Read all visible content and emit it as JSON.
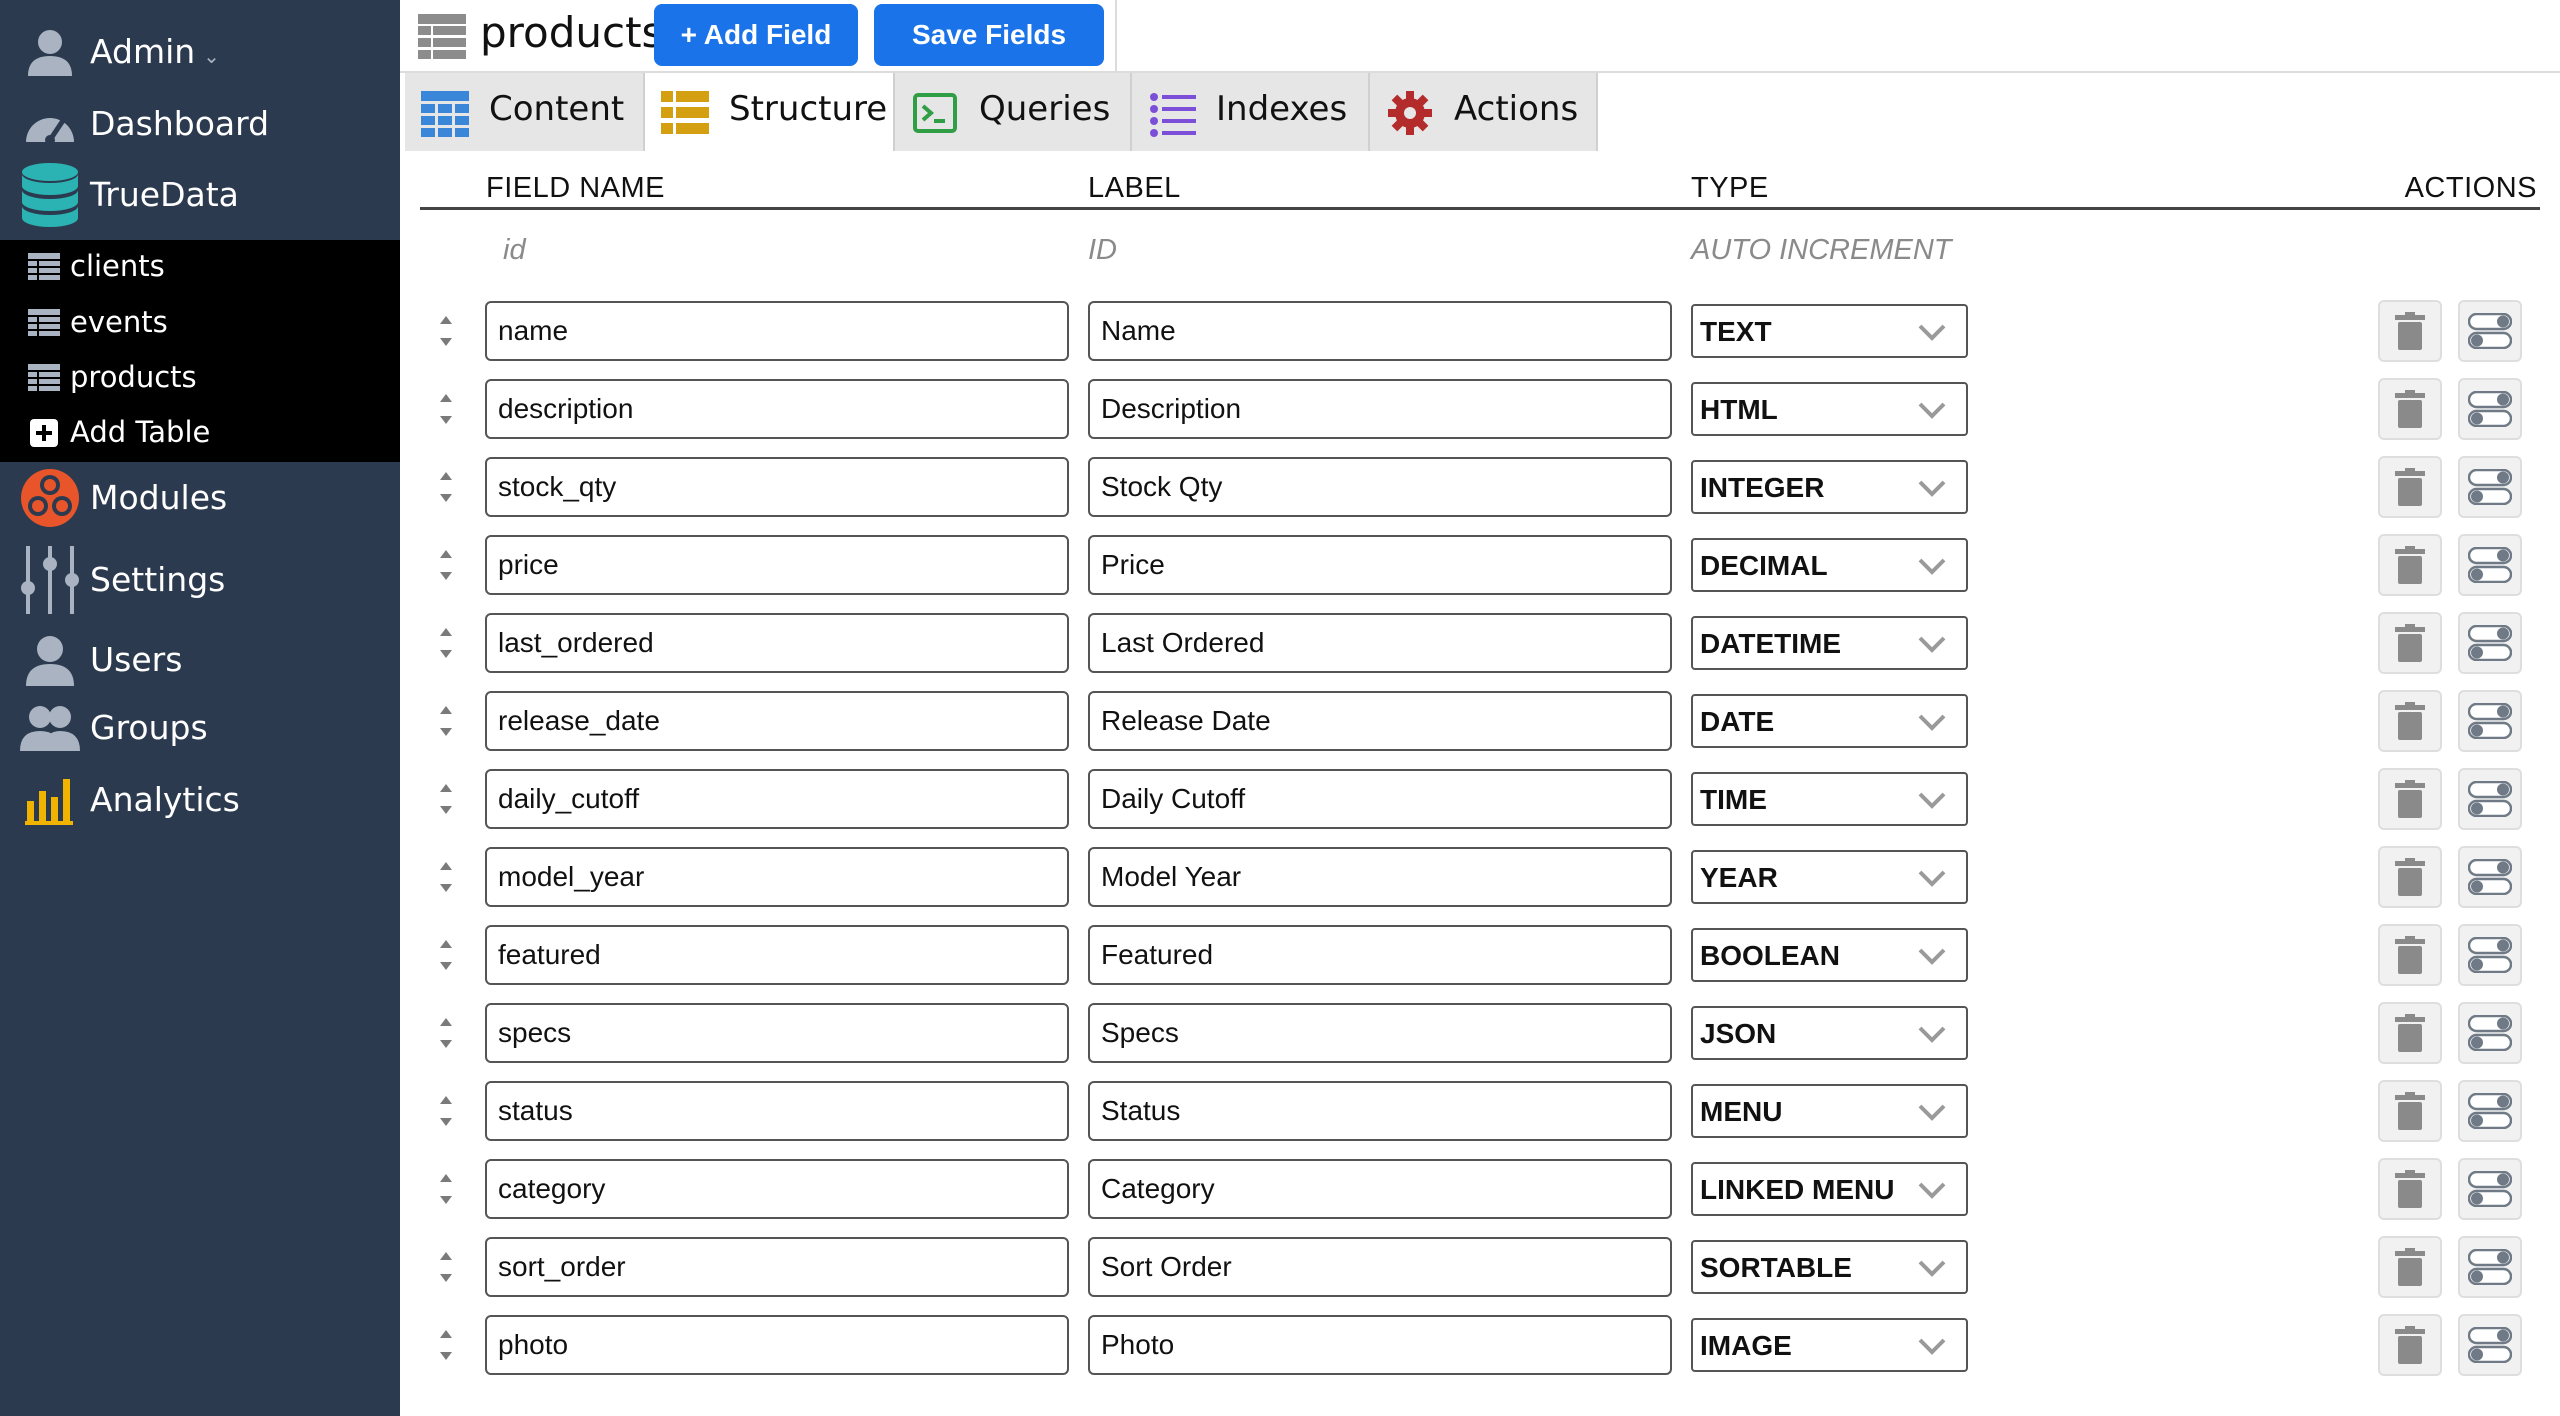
{
  "colors": {
    "sidebar_bg": "#2c3a4f",
    "sidebar_sub_bg": "#000000",
    "primary_button": "#1a73e8"
  },
  "sidebar": {
    "admin": {
      "label": "Admin",
      "caret": "⌄",
      "icon": "user-icon"
    },
    "items": [
      {
        "label": "Dashboard",
        "icon": "dashboard-gauge-icon"
      },
      {
        "label": "TrueData",
        "icon": "database-icon"
      },
      {
        "label": "Modules",
        "icon": "modules-icon"
      },
      {
        "label": "Settings",
        "icon": "sliders-icon"
      },
      {
        "label": "Users",
        "icon": "user-icon"
      },
      {
        "label": "Groups",
        "icon": "group-icon"
      },
      {
        "label": "Analytics",
        "icon": "bar-chart-icon"
      }
    ],
    "tables": [
      {
        "label": "clients",
        "icon": "table-icon"
      },
      {
        "label": "events",
        "icon": "table-icon"
      },
      {
        "label": "products",
        "icon": "table-icon"
      }
    ],
    "add_table": {
      "label": "Add Table",
      "icon": "plus-square-icon"
    }
  },
  "header": {
    "title": "products",
    "add_field": "+ Add Field",
    "save_fields": "Save Fields"
  },
  "tabs": [
    {
      "label": "Content",
      "icon": "grid-icon",
      "active": false
    },
    {
      "label": "Structure",
      "icon": "structure-icon",
      "active": true
    },
    {
      "label": "Queries",
      "icon": "terminal-icon",
      "active": false
    },
    {
      "label": "Indexes",
      "icon": "list-icon",
      "active": false
    },
    {
      "label": "Actions",
      "icon": "gear-icon",
      "active": false
    }
  ],
  "columns": {
    "field_name": "FIELD NAME",
    "label": "LABEL",
    "type": "TYPE",
    "actions": "ACTIONS"
  },
  "id_row": {
    "field_name": "id",
    "label": "ID",
    "type": "AUTO INCREMENT"
  },
  "fields": [
    {
      "name": "name",
      "label": "Name",
      "type": "TEXT"
    },
    {
      "name": "description",
      "label": "Description",
      "type": "HTML"
    },
    {
      "name": "stock_qty",
      "label": "Stock Qty",
      "type": "INTEGER"
    },
    {
      "name": "price",
      "label": "Price",
      "type": "DECIMAL"
    },
    {
      "name": "last_ordered",
      "label": "Last Ordered",
      "type": "DATETIME"
    },
    {
      "name": "release_date",
      "label": "Release Date",
      "type": "DATE"
    },
    {
      "name": "daily_cutoff",
      "label": "Daily Cutoff",
      "type": "TIME"
    },
    {
      "name": "model_year",
      "label": "Model Year",
      "type": "YEAR"
    },
    {
      "name": "featured",
      "label": "Featured",
      "type": "BOOLEAN"
    },
    {
      "name": "specs",
      "label": "Specs",
      "type": "JSON"
    },
    {
      "name": "status",
      "label": "Status",
      "type": "MENU"
    },
    {
      "name": "category",
      "label": "Category",
      "type": "LINKED MENU"
    },
    {
      "name": "sort_order",
      "label": "Sort Order",
      "type": "SORTABLE"
    },
    {
      "name": "photo",
      "label": "Photo",
      "type": "IMAGE"
    }
  ]
}
